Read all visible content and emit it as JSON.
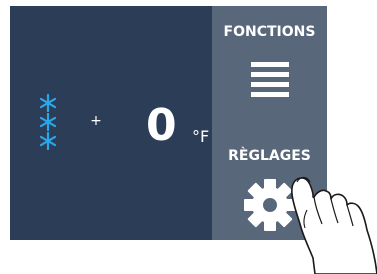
{
  "display": {
    "freezer_icon": "snowflake-icon",
    "sign": "+",
    "temperature_value": "0",
    "temperature_unit": "°F"
  },
  "panel": {
    "functions_label": "FONCTIONS",
    "functions_icon": "hamburger-menu-icon",
    "settings_label": "RÈGLAGES",
    "settings_icon": "gear-icon"
  },
  "colors": {
    "screen_background": "#2b3d57",
    "panel_background": "#59677a",
    "snowflake": "#2aa7e8",
    "text": "#ffffff"
  }
}
